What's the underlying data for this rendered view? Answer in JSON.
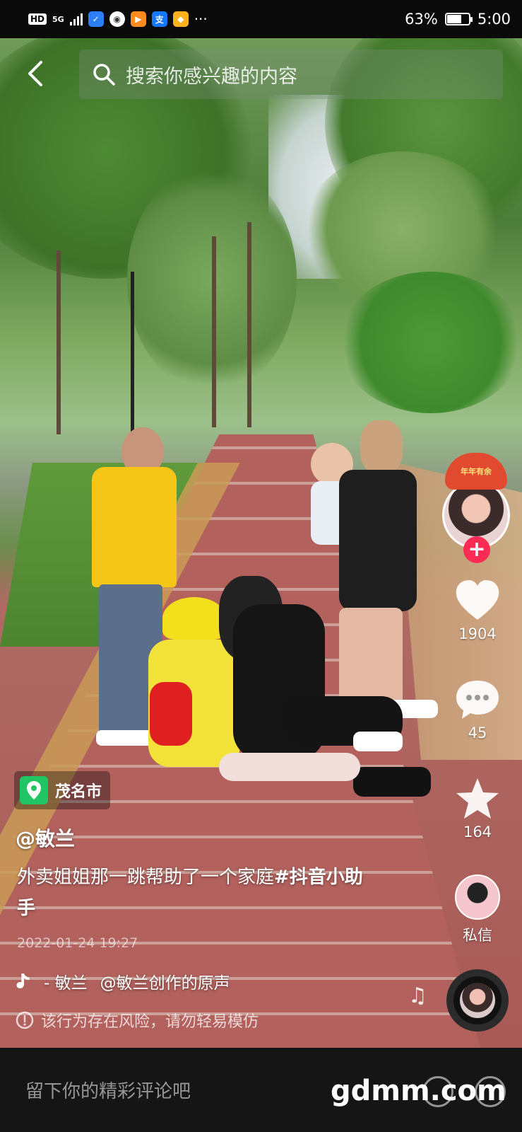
{
  "status_bar": {
    "hd": "HD",
    "network": "5G",
    "battery_percent": "63%",
    "battery_level": 0.63,
    "time": "5:00"
  },
  "search": {
    "placeholder": "搜索你感兴趣的内容"
  },
  "creator_avatar": {
    "hat_text": "年年有余"
  },
  "actions": {
    "likes": "1904",
    "comments": "45",
    "favorites": "164",
    "message_label": "私信"
  },
  "location": {
    "name": "茂名市"
  },
  "post": {
    "author": "@敏兰",
    "description": "外卖姐姐那一跳帮助了一个家庭",
    "hashtag": "#抖音小助手",
    "date": "2022-01-24 19:27"
  },
  "music": {
    "artist": "- 敏兰",
    "title": "@敏兰创作的原声"
  },
  "warning": {
    "text": "该行为存在风险，请勿轻易模仿"
  },
  "bottom_bar": {
    "comment_placeholder": "留下你的精彩评论吧",
    "watermark": "gdmm.com"
  },
  "icons": [
    "back-icon",
    "search-icon",
    "heart-icon",
    "comment-icon",
    "star-icon",
    "location-pin-icon",
    "tiktok-note-icon",
    "warning-icon",
    "music-note-icon"
  ],
  "colors": {
    "follow": "#fe2c55",
    "location_pin": "#22c564"
  }
}
